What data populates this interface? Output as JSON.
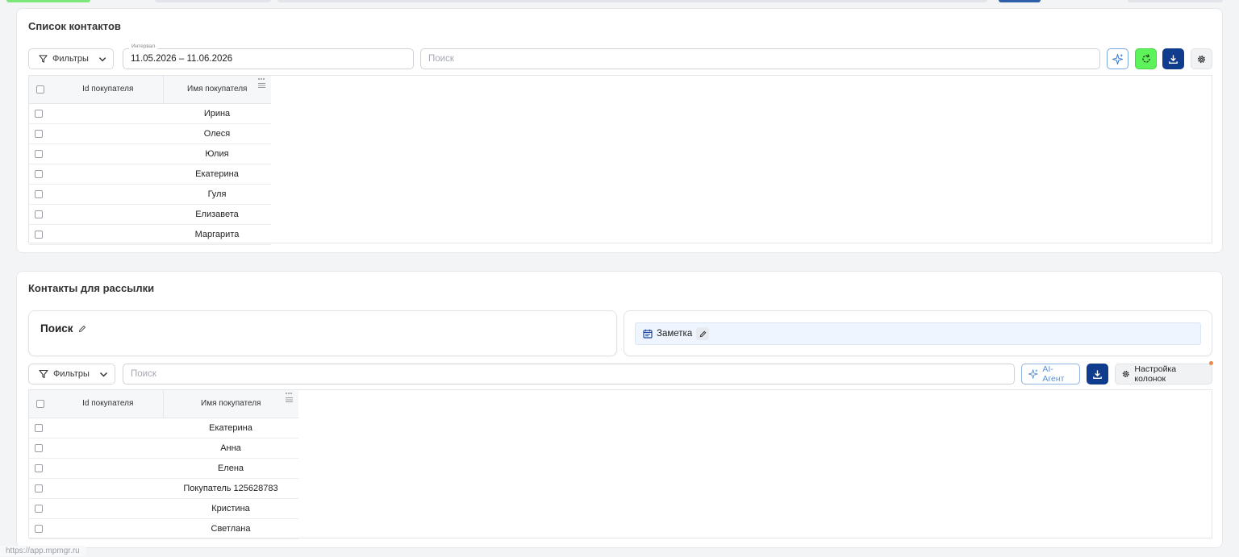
{
  "colors": {
    "accent_blue": "#0f3c8c",
    "accent_green": "#5ef25b",
    "ai_border": "#7aa7dc",
    "note_bg": "#eef5ff",
    "notify_dot": "#e98a4a"
  },
  "contacts_panel": {
    "title": "Список контактов",
    "filters_label": "Фильтры",
    "interval_label": "Интервал",
    "interval_value": "11.05.2026 – 11.06.2026",
    "search_placeholder": "Поиск",
    "icons": [
      "sparkle-icon",
      "refresh-icon",
      "download-icon",
      "gear-icon"
    ],
    "columns": [
      "Id покупателя",
      "Имя покупателя"
    ],
    "rows": [
      {
        "id": "",
        "name": "Ирина"
      },
      {
        "id": "",
        "name": "Олеся"
      },
      {
        "id": "",
        "name": "Юлия"
      },
      {
        "id": "",
        "name": "Екатерина"
      },
      {
        "id": "",
        "name": "Гуля"
      },
      {
        "id": "",
        "name": "Елизавета"
      },
      {
        "id": "",
        "name": "Маргарита"
      }
    ]
  },
  "mailing_panel": {
    "title": "Контакты для рассылки",
    "search_card_title": "Поиск",
    "note_label": "Заметка",
    "filters_label": "Фильтры",
    "search_placeholder": "Поиск",
    "ai_agent_label": "AI-Агент",
    "columns_settings_label": "Настройка колонок",
    "columns": [
      "Id покупателя",
      "Имя покупателя"
    ],
    "rows": [
      {
        "id": "",
        "name": "Екатерина"
      },
      {
        "id": "",
        "name": "Анна"
      },
      {
        "id": "",
        "name": "Елена"
      },
      {
        "id": "",
        "name": "Покупатель 125628783"
      },
      {
        "id": "",
        "name": "Кристина"
      },
      {
        "id": "",
        "name": "Светлана"
      }
    ]
  },
  "status_bar": {
    "url": "https://app.mpmgr.ru"
  }
}
